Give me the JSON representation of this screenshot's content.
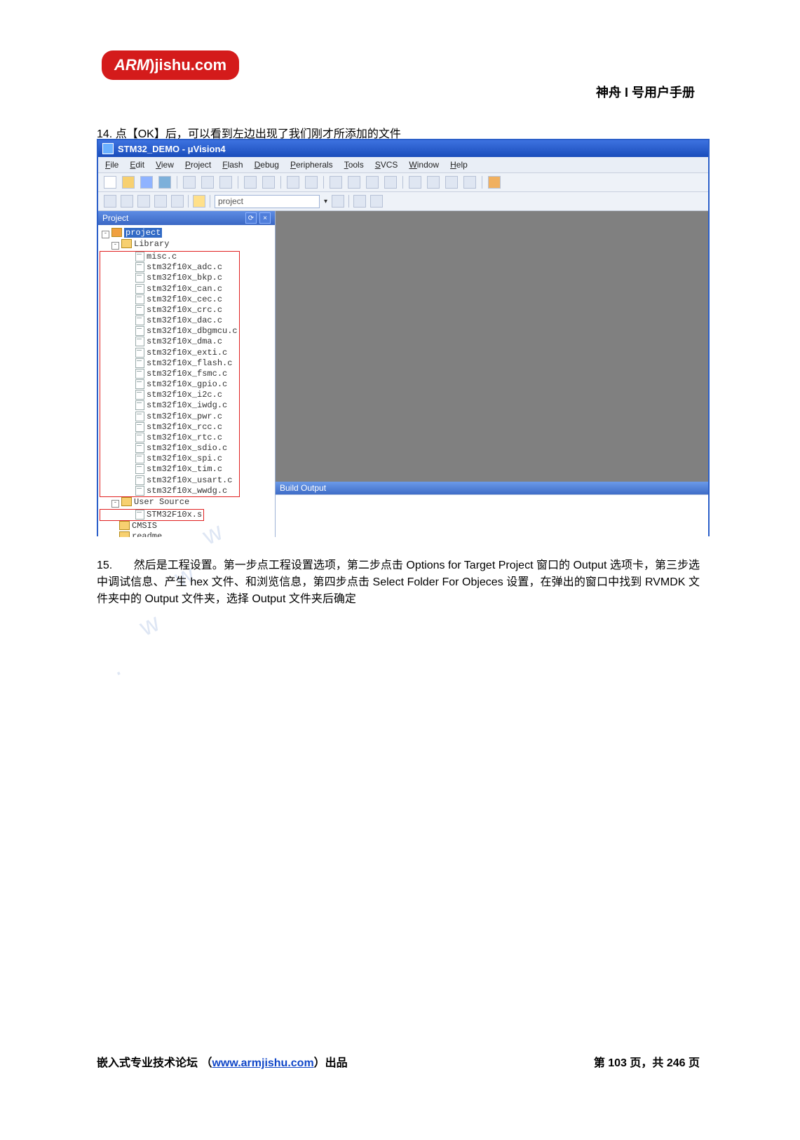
{
  "header": {
    "logo_arm": "ARM",
    "logo_rest": "jishu.com",
    "title": "神舟 I 号用户手册"
  },
  "step14": {
    "num": "14.",
    "text": "点【OK】后，可以看到左边出现了我们刚才所添加的文件"
  },
  "ide": {
    "title": "STM32_DEMO  -  μVision4",
    "menus": [
      "File",
      "Edit",
      "View",
      "Project",
      "Flash",
      "Debug",
      "Peripherals",
      "Tools",
      "SVCS",
      "Window",
      "Help"
    ],
    "target_name": "project",
    "project_panel_title": "Project",
    "build_output_title": "Build Output",
    "tree": {
      "root": "project",
      "library": {
        "name": "Library",
        "files": [
          "misc.c",
          "stm32f10x_adc.c",
          "stm32f10x_bkp.c",
          "stm32f10x_can.c",
          "stm32f10x_cec.c",
          "stm32f10x_crc.c",
          "stm32f10x_dac.c",
          "stm32f10x_dbgmcu.c",
          "stm32f10x_dma.c",
          "stm32f10x_exti.c",
          "stm32f10x_flash.c",
          "stm32f10x_fsmc.c",
          "stm32f10x_gpio.c",
          "stm32f10x_i2c.c",
          "stm32f10x_iwdg.c",
          "stm32f10x_pwr.c",
          "stm32f10x_rcc.c",
          "stm32f10x_rtc.c",
          "stm32f10x_sdio.c",
          "stm32f10x_spi.c",
          "stm32f10x_tim.c",
          "stm32f10x_usart.c",
          "stm32f10x_wwdg.c"
        ]
      },
      "user_source": {
        "name": "User Source",
        "files": [
          "STM32F10x.s"
        ]
      },
      "cmsis": "CMSIS",
      "readme": "readme"
    }
  },
  "step15": {
    "num": "15.",
    "text": "然后是工程设置。第一步点工程设置选项，第二步点击 Options for Target Project 窗口的 Output 选项卡，第三步选中调试信息、产生 hex 文件、和浏览信息，第四步点击 Select Folder For Objeces 设置，在弹出的窗口中找到 RVMDK 文件夹中的 Output 文件夹，选择 Output 文件夹后确定"
  },
  "footer": {
    "left_a": "嵌入式专业技术论坛  （",
    "link": "www.armjishu.com",
    "left_b": "）出品",
    "right": "第 103 页，共 246 页"
  }
}
